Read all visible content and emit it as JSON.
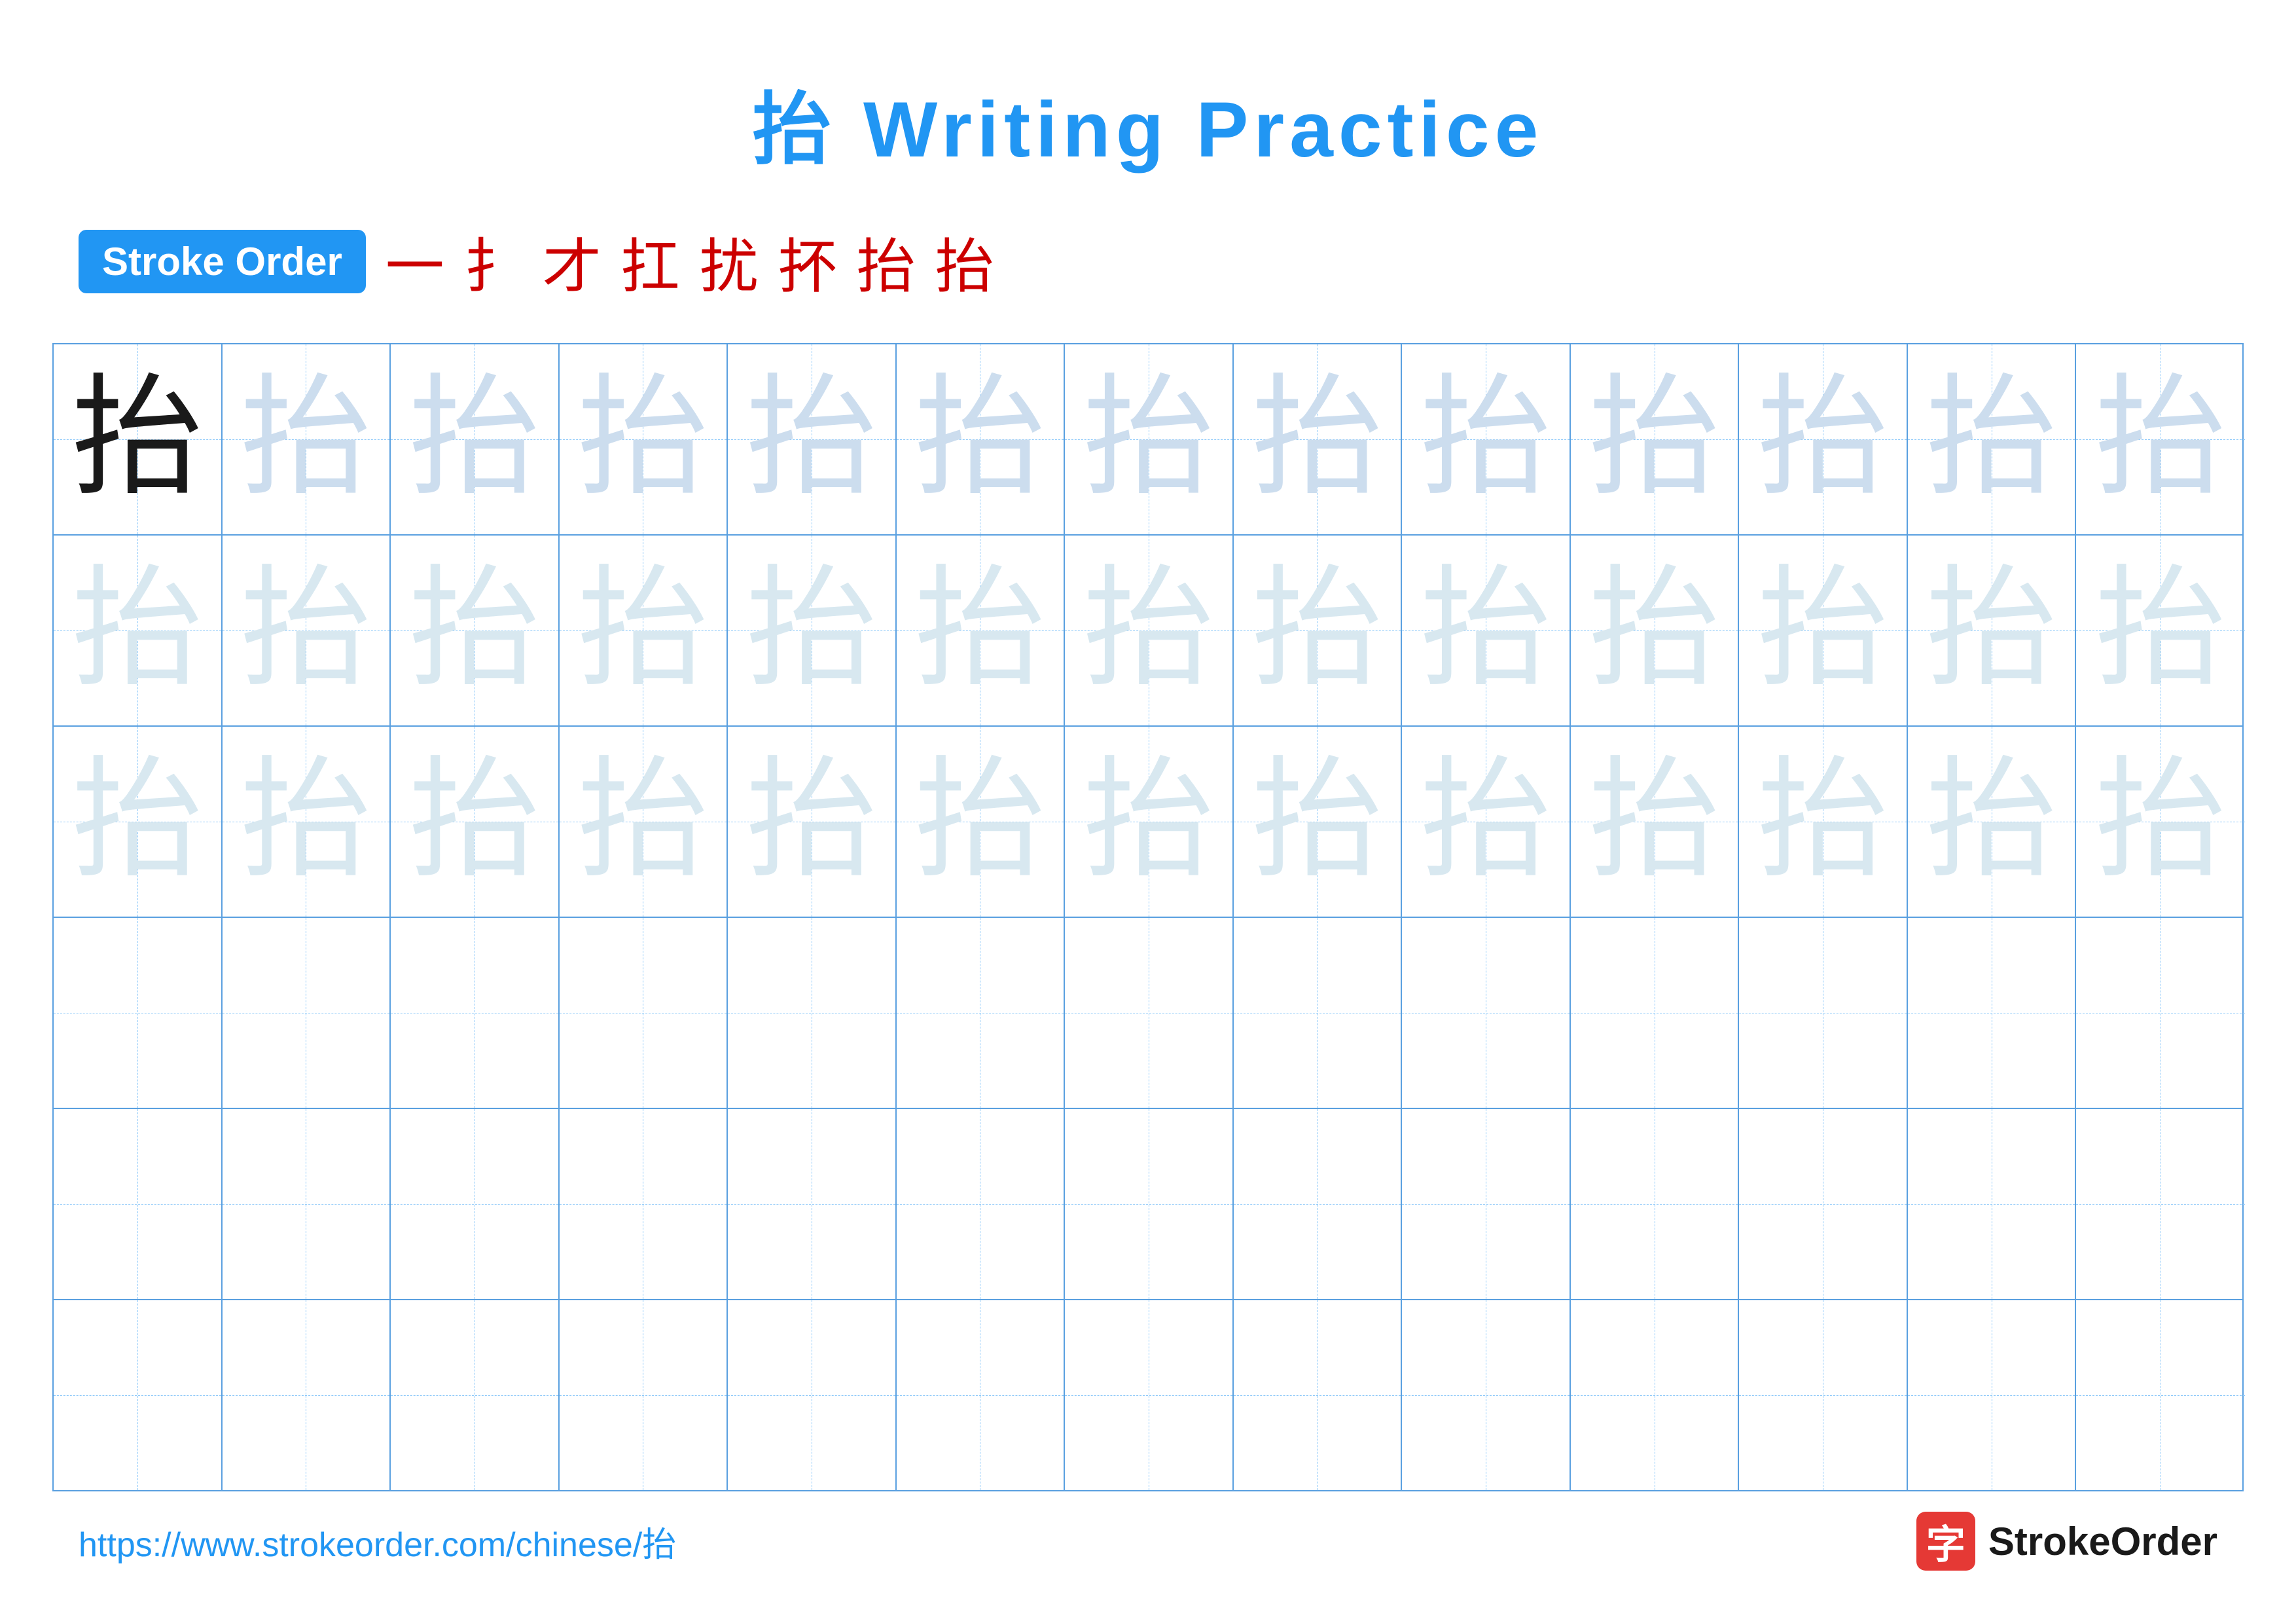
{
  "title": "抬 Writing Practice",
  "stroke_order_label": "Stroke Order",
  "stroke_sequence": [
    "一",
    "扌",
    "才",
    "扛",
    "扰",
    "抔",
    "抬",
    "抬"
  ],
  "character": "抬",
  "rows": [
    {
      "type": "solid_then_light",
      "solid_count": 1,
      "light_count": 12
    },
    {
      "type": "all_lighter",
      "count": 13
    },
    {
      "type": "all_lighter",
      "count": 13
    },
    {
      "type": "empty",
      "count": 13
    },
    {
      "type": "empty",
      "count": 13
    },
    {
      "type": "empty",
      "count": 13
    }
  ],
  "footer": {
    "url": "https://www.strokeorder.com/chinese/抬",
    "brand": "StrokeOrder",
    "logo_char": "字"
  }
}
